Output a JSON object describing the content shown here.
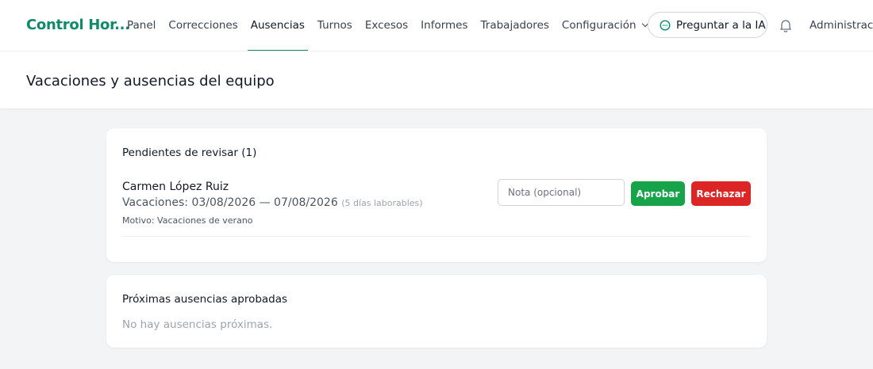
{
  "app": {
    "brand": "Control Hor..."
  },
  "nav": {
    "items": [
      {
        "label": "Panel"
      },
      {
        "label": "Correcciones"
      },
      {
        "label": "Ausencias"
      },
      {
        "label": "Turnos"
      },
      {
        "label": "Excesos"
      },
      {
        "label": "Informes"
      },
      {
        "label": "Trabajadores"
      },
      {
        "label": "Configuración"
      }
    ],
    "active": "Ausencias",
    "ai_button": "Preguntar a la IA",
    "user": "Administraci"
  },
  "header": {
    "title": "Vacaciones y ausencias del equipo"
  },
  "pending": {
    "title": "Pendientes de revisar (1)",
    "requests": [
      {
        "name": "Carmen López Ruiz",
        "dates": "Vacaciones: 03/08/2026 — 07/08/2026",
        "days": "(5 días laborables)",
        "reason": "Motivo: Vacaciones de verano",
        "note_placeholder": "Nota (opcional)",
        "note_value": "",
        "approve_label": "Aprobar",
        "reject_label": "Rechazar"
      }
    ]
  },
  "upcoming": {
    "title": "Próximas ausencias aprobadas",
    "empty": "No hay ausencias próximas."
  },
  "colors": {
    "brand": "#0f8a6b",
    "approve": "#16a34a",
    "reject": "#dc2626",
    "background": "#f3f4f6"
  },
  "icons": [
    "chat-icon",
    "bell-icon",
    "chevron-down-icon"
  ]
}
